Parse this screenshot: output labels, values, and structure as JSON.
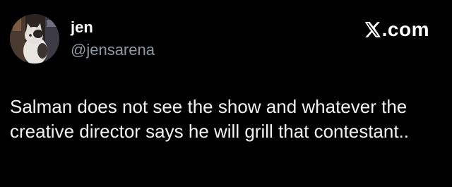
{
  "author": {
    "display_name": "jen",
    "handle": "@jensarena",
    "avatar_icon": "profile-photo-cat"
  },
  "brand": {
    "logo_icon": "x-logo-icon",
    "text": ".com"
  },
  "tweet": {
    "text": "Salman does not see the show and whatever the creative director says he will grill that contestant.."
  },
  "colors": {
    "background": "#000000",
    "primary_text": "#e7e9ea",
    "secondary_text": "#8b98a5"
  }
}
